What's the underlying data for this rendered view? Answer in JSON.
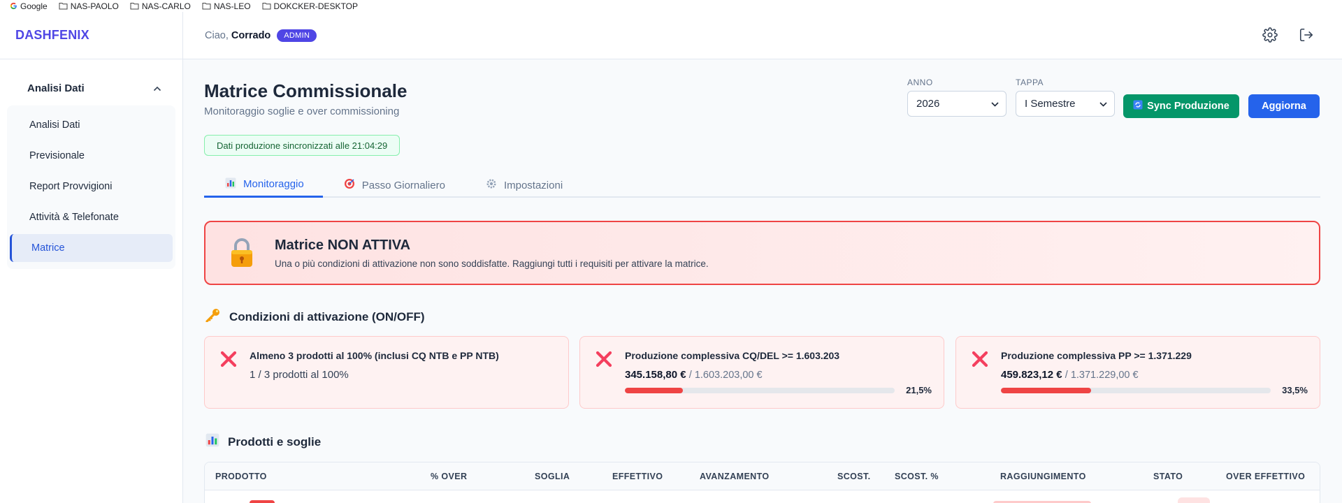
{
  "bookmarks": [
    "Google",
    "NAS-PAOLO",
    "NAS-CARLO",
    "NAS-LEO",
    "DOKCKER-DESKTOP"
  ],
  "brand": "DASHFENIX",
  "sidebar": {
    "group_label": "Analisi Dati",
    "items": [
      {
        "label": "Analisi Dati",
        "active": false
      },
      {
        "label": "Previsionale",
        "active": false
      },
      {
        "label": "Report Provvigioni",
        "active": false
      },
      {
        "label": "Attività & Telefonate",
        "active": false
      },
      {
        "label": "Matrice",
        "active": true
      }
    ]
  },
  "header": {
    "greeting": "Ciao,",
    "user": "Corrado",
    "role_badge": "ADMIN",
    "icons": [
      "gear-icon",
      "logout-icon"
    ]
  },
  "page": {
    "title": "Matrice Commissionale",
    "subtitle": "Monitoraggio soglie e over commissioning",
    "sync_status": "Dati produzione sincronizzati alle 21:04:29"
  },
  "filters": {
    "anno_label": "ANNO",
    "anno_value": "2026",
    "tappa_label": "TAPPA",
    "tappa_value": "I Semestre"
  },
  "buttons": {
    "sync": "Sync Produzione",
    "refresh": "Aggiorna"
  },
  "tabs": [
    {
      "label": "Monitoraggio",
      "icon": "bar-chart-icon",
      "active": true
    },
    {
      "label": "Passo Giornaliero",
      "icon": "target-icon",
      "active": false
    },
    {
      "label": "Impostazioni",
      "icon": "gear-icon",
      "active": false
    }
  ],
  "alert": {
    "title": "Matrice NON ATTIVA",
    "text": "Una o più condizioni di attivazione non sono soddisfatte. Raggiungi tutti i requisiti per attivare la matrice.",
    "icon": "lock-icon",
    "color": "#ef4444"
  },
  "conditions_section": {
    "title": "Condizioni di attivazione (ON/OFF)",
    "icon": "key-icon"
  },
  "conditions": [
    {
      "title": "Almeno 3 prodotti al 100% (inclusi CQ NTB e PP NTB)",
      "value": "1 / 3 prodotti al 100%",
      "total": "",
      "percent_label": "",
      "progress": null
    },
    {
      "title": "Produzione complessiva CQ/DEL >= 1.603.203",
      "value": "345.158,80 €",
      "total": "/ 1.603.203,00 €",
      "percent_label": "21,5%",
      "progress": 0.215
    },
    {
      "title": "Produzione complessiva PP >= 1.371.229",
      "value": "459.823,12 €",
      "total": "/ 1.371.229,00 €",
      "percent_label": "33,5%",
      "progress": 0.335
    }
  ],
  "products_section": {
    "title": "Prodotti e soglie",
    "icon": "bar-chart-icon"
  },
  "table": {
    "columns": [
      "PRODOTTO",
      "% OVER",
      "SOGLIA",
      "EFFETTIVO",
      "AVANZAMENTO",
      "SCOST.",
      "SCOST. %",
      "RAGGIUNGIMENTO",
      "STATO",
      "OVER EFFETTIVO"
    ]
  },
  "colors": {
    "brand": "#4f46e5",
    "primary": "#2563eb",
    "success": "#059669",
    "danger": "#ef4444"
  }
}
